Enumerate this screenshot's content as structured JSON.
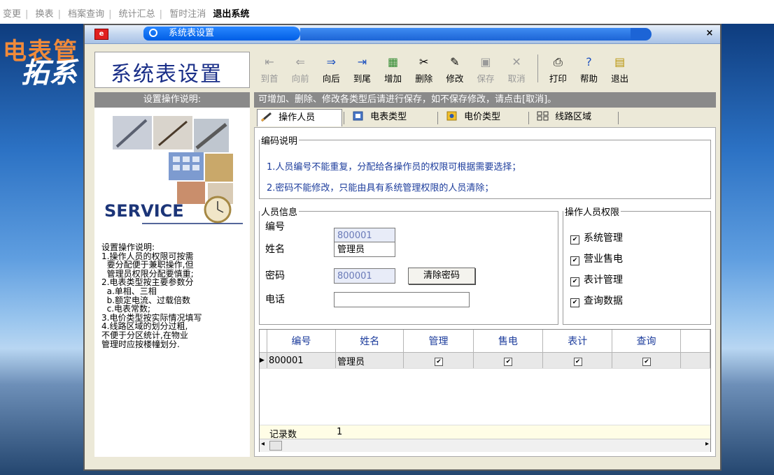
{
  "top_menu": {
    "items": [
      "变更",
      "换表",
      "档案查询",
      "统计汇总",
      "暂时注消"
    ],
    "exit": "退出系统"
  },
  "background": {
    "title_line1": "电表管",
    "title_line2": "拓系"
  },
  "window": {
    "title": "系统表设置",
    "close": "×"
  },
  "caption": "系统表设置",
  "toolbar": {
    "first": "到首",
    "prev": "向前",
    "next": "向后",
    "last": "到尾",
    "add": "增加",
    "delete": "删除",
    "edit": "修改",
    "save": "保存",
    "cancel": "取消",
    "print": "打印",
    "help": "帮助",
    "exit": "退出"
  },
  "left_panel": {
    "heading": "设置操作说明:",
    "service_word": "SERVICE",
    "text": "设置操作说明:\n1.操作人员的权限可按需\n  要分配便于兼职操作,但\n  管理员权限分配要慎重;\n2.电表类型按主要参数分\n  a.单相、三相\n  b.额定电流、过载倍数\n  c.电表常数;\n3.电价类型按实际情况填写\n4.线路区域的划分过粗,\n不便于分区统计,在物业\n管理时应按楼幢划分."
  },
  "info_bar": "可增加、删除、修改各类型后请进行保存，如不保存修改，请点击[取消]。",
  "tabs": [
    "操作人员",
    "电表类型",
    "电价类型",
    "线路区域"
  ],
  "code_desc": {
    "legend": "编码说明",
    "line1": "1.人员编号不能重复，分配给各操作员的权限可根据需要选择；",
    "line2": "2.密码不能修改，只能由具有系统管理权限的人员清除；"
  },
  "person": {
    "legend": "人员信息",
    "id_label": "编号",
    "id_value": "800001",
    "name_label": "姓名",
    "name_value": "管理员",
    "pwd_label": "密码",
    "pwd_value": "800001",
    "clear_btn": "清除密码",
    "phone_label": "电话",
    "phone_value": ""
  },
  "permissions": {
    "legend": "操作人员权限",
    "items": [
      "系统管理",
      "营业售电",
      "表计管理",
      "查询数据"
    ],
    "checked": [
      true,
      true,
      true,
      true
    ]
  },
  "grid": {
    "columns": [
      "编号",
      "姓名",
      "管理",
      "售电",
      "表计",
      "查询"
    ],
    "rows": [
      {
        "id": "800001",
        "name": "管理员",
        "manage": true,
        "sell": true,
        "meter": true,
        "query": true
      }
    ],
    "footer_label": "记录数",
    "footer_count": "1"
  }
}
